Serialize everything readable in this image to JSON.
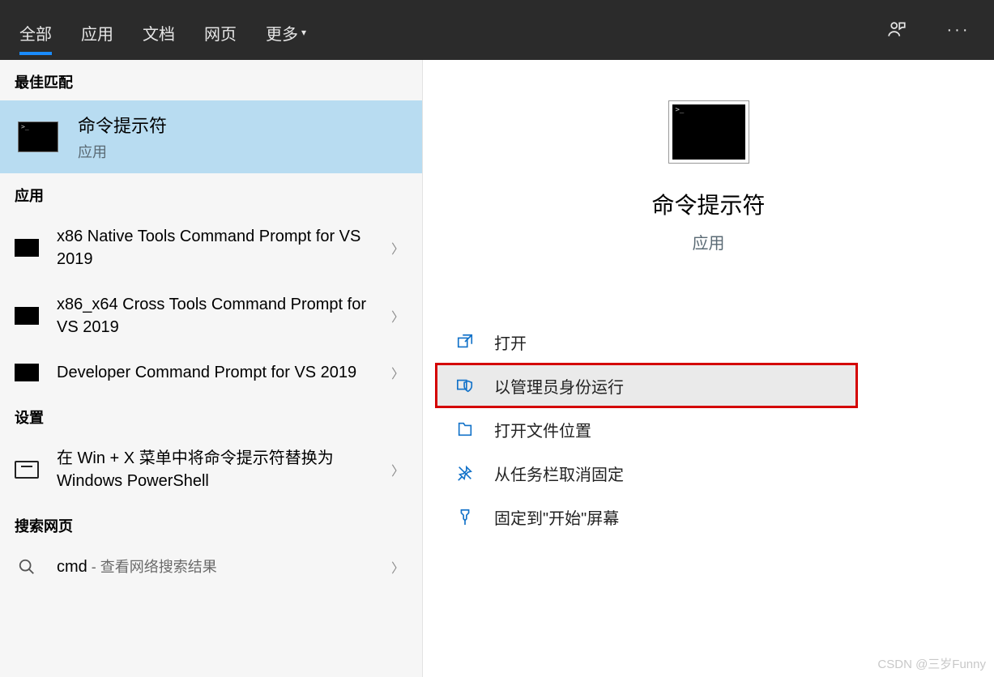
{
  "tabs": {
    "all": "全部",
    "apps": "应用",
    "docs": "文档",
    "web": "网页",
    "more": "更多"
  },
  "sections": {
    "best": "最佳匹配",
    "apps": "应用",
    "settings": "设置",
    "web": "搜索网页"
  },
  "best": {
    "title": "命令提示符",
    "sub": "应用"
  },
  "appList": [
    {
      "label": "x86 Native Tools Command Prompt for VS 2019"
    },
    {
      "label": "x86_x64 Cross Tools Command Prompt for VS 2019"
    },
    {
      "label": "Developer Command Prompt for VS 2019"
    }
  ],
  "settingsItem": "在 Win + X 菜单中将命令提示符替换为 Windows PowerShell",
  "webItem": {
    "term": "cmd",
    "suffix": " - 查看网络搜索结果"
  },
  "detail": {
    "title": "命令提示符",
    "sub": "应用"
  },
  "actions": {
    "open": "打开",
    "admin": "以管理员身份运行",
    "location": "打开文件位置",
    "unpin": "从任务栏取消固定",
    "pinstart": "固定到\"开始\"屏幕"
  },
  "watermark": "CSDN @三岁Funny"
}
